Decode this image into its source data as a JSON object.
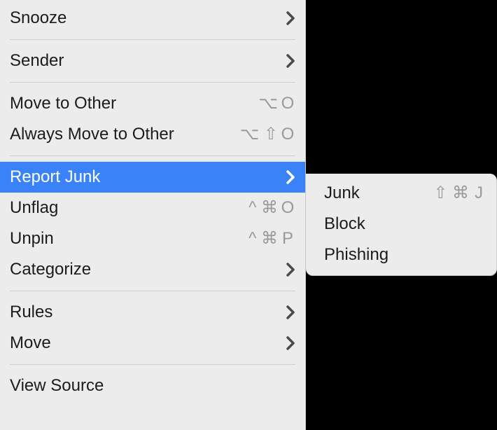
{
  "menu": {
    "snooze": {
      "label": "Snooze"
    },
    "sender": {
      "label": "Sender"
    },
    "move_to_other": {
      "label": "Move to Other",
      "sc_glyphs": "⌥",
      "sc_letter": "O"
    },
    "always_move_to_other": {
      "label": "Always Move to Other",
      "sc_glyphs": "⌥ ⇧",
      "sc_letter": "O"
    },
    "report_junk": {
      "label": "Report Junk"
    },
    "unflag": {
      "label": "Unflag",
      "sc_glyphs": "^ ⌘",
      "sc_letter": "O"
    },
    "unpin": {
      "label": "Unpin",
      "sc_glyphs": "^ ⌘",
      "sc_letter": "P"
    },
    "categorize": {
      "label": "Categorize"
    },
    "rules": {
      "label": "Rules"
    },
    "move": {
      "label": "Move"
    },
    "view_source": {
      "label": "View Source"
    }
  },
  "submenu": {
    "junk": {
      "label": "Junk",
      "sc_glyphs": "⇧ ⌘",
      "sc_letter": "J"
    },
    "block": {
      "label": "Block"
    },
    "phishing": {
      "label": "Phishing"
    }
  }
}
